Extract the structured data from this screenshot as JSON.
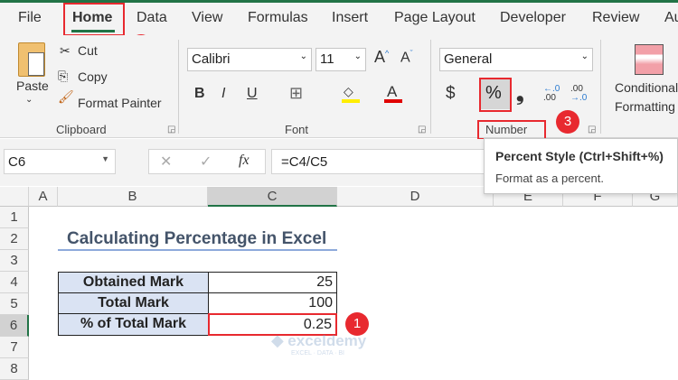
{
  "tabs": [
    "File",
    "Home",
    "Data",
    "View",
    "Formulas",
    "Insert",
    "Page Layout",
    "Developer",
    "Review",
    "Au"
  ],
  "clipboard": {
    "paste": "Paste",
    "cut": "Cut",
    "copy": "Copy",
    "format_painter": "Format Painter",
    "group": "Clipboard"
  },
  "font": {
    "name": "Calibri",
    "size": "11",
    "group": "Font",
    "bold": "B",
    "italic": "I",
    "underline": "U"
  },
  "number": {
    "format": "General",
    "currency": "$",
    "percent": "%",
    "comma": "❟",
    "group": "Number"
  },
  "styles": {
    "conditional": "Conditional",
    "formatting": "Formatting"
  },
  "badges": [
    "1",
    "2",
    "3"
  ],
  "formula_bar": {
    "name_box": "C6",
    "formula": "=C4/C5",
    "fx": "fx"
  },
  "tooltip": {
    "title": "Percent Style (Ctrl+Shift+%)",
    "desc": "Format as a percent."
  },
  "columns": [
    "A",
    "B",
    "C",
    "D",
    "E",
    "F",
    "G"
  ],
  "rows": [
    "1",
    "2",
    "3",
    "4",
    "5",
    "6",
    "7",
    "8"
  ],
  "sheet": {
    "title": "Calculating Percentage in Excel",
    "table": [
      {
        "label": "Obtained Mark",
        "value": "25"
      },
      {
        "label": "Total Mark",
        "value": "100"
      },
      {
        "label": "% of Total Mark",
        "value": "0.25"
      }
    ]
  },
  "watermark": {
    "name": "exceldemy",
    "tagline": "EXCEL · DATA · BI"
  },
  "colors": {
    "accent": "#217346",
    "highlight": "#e8292f",
    "label_fill": "#dae3f3"
  }
}
